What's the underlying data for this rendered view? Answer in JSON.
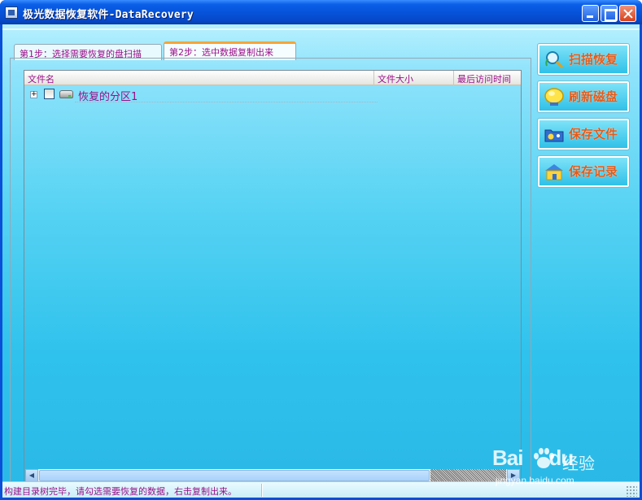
{
  "window": {
    "title": "极光数据恢复软件-DataRecovery"
  },
  "tabs": [
    {
      "label": "第1步：选择需要恢复的盘扫描",
      "active": false
    },
    {
      "label": "第2步：选中数据复制出来",
      "active": true
    }
  ],
  "list": {
    "columns": [
      "文件名",
      "文件大小",
      "最后访问时间"
    ],
    "rows": [
      {
        "label": "恢复的分区1",
        "expander": "+",
        "checked": false,
        "icon": "drive-icon"
      }
    ]
  },
  "buttons": [
    {
      "label": "扫描恢复",
      "icon": "magnifier-scan-icon"
    },
    {
      "label": "刷新磁盘",
      "icon": "refresh-disk-icon"
    },
    {
      "label": "保存文件",
      "icon": "save-file-icon"
    },
    {
      "label": "保存记录",
      "icon": "save-record-icon"
    }
  ],
  "status": {
    "text": "构建目录树完毕，请勾选需要恢复的数据，右击复制出来。"
  },
  "watermark": {
    "brand": "Bai",
    "brand2": "du",
    "cn": "经验",
    "url": "jingyan.baidu.com"
  },
  "colors": {
    "accent_text": "#9a0f86",
    "button_text": "#e35b19",
    "titlebar": "#0652d8",
    "client_bg_top": "#b6f0ff",
    "client_bg_bottom": "#2ab8e6"
  }
}
